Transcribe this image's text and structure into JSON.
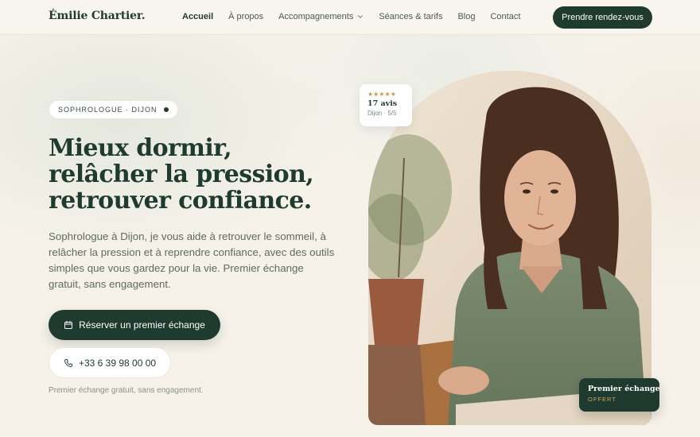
{
  "brand": {
    "name": "Émilie Chartier."
  },
  "nav": {
    "items": [
      {
        "label": "Accueil",
        "active": true
      },
      {
        "label": "À propos"
      },
      {
        "label": "Accompagnements",
        "has_dropdown": true
      },
      {
        "label": "Séances & tarifs"
      },
      {
        "label": "Blog"
      },
      {
        "label": "Contact"
      }
    ],
    "cta_label": "Prendre rendez-vous"
  },
  "hero": {
    "badge": "SOPHROLOGUE · DIJON",
    "headline": "Mieux dormir, relâcher la pression, retrouver confiance.",
    "lead": "Sophrologue à Dijon, je vous aide à retrouver le sommeil, à relâcher la pression et à reprendre confiance, avec des outils simples que vous gardez pour la vie. Premier échange gratuit, sans engagement.",
    "primary_button": {
      "label": "Réserver un premier échange",
      "icon": "calendar-icon"
    },
    "secondary_button": {
      "label": "+33 6 39 98 00 00",
      "icon": "phone-icon"
    },
    "note": "Premier échange gratuit, sans engagement."
  },
  "rating_card": {
    "stars": "★★★★★",
    "rating": 5,
    "count": "17 avis",
    "place": "Dijon · 5/5"
  },
  "offer_card": {
    "title": "Premier échange",
    "subtitle": "OFFERT"
  },
  "colors": {
    "accent": "#1f3a2f",
    "background": "#f6f2ea",
    "gold": "#c49a54"
  }
}
